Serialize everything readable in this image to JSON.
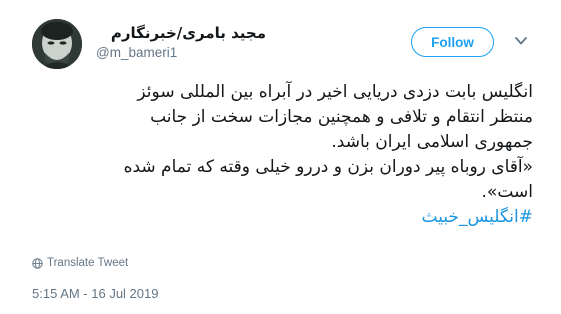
{
  "user": {
    "display_name": "مجید بامری/خبرنگارم",
    "handle": "@m_bameri1"
  },
  "follow_label": "Follow",
  "tweet": {
    "lines": [
      "انگلیس بابت دزدی دریایی اخیر در آبراه بین المللی سوئز",
      "منتظر انتقام و تلافی و همچنین مجازات سخت از جانب",
      "جمهوری اسلامی ایران باشد.",
      "«آقای روباه پیر دوران بزن و دررو خیلی وقته که تمام شده",
      "است»."
    ],
    "hashtag": "#انگلیس_خبیث"
  },
  "translate_label": "Translate Tweet",
  "timestamp": "5:15 AM - 16 Jul 2019",
  "colors": {
    "accent": "#1da1f2",
    "hashtag": "#1b95e0",
    "muted": "#657786"
  },
  "icons": {
    "menu": "chevron-down-icon",
    "translate": "globe-icon"
  }
}
